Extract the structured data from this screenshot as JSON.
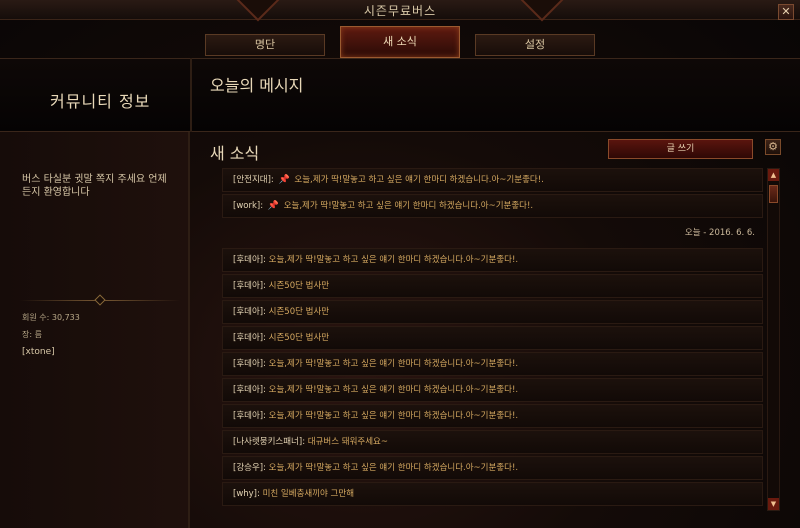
{
  "window": {
    "title": "시즌무료버스",
    "close_label": "✕"
  },
  "tabs": [
    {
      "label": "명단"
    },
    {
      "label": "새 소식"
    },
    {
      "label": "설정"
    }
  ],
  "header": {
    "community_title": "커뮤니티 정보",
    "section_title": "오늘의 메시지"
  },
  "sidebar": {
    "description": "버스 타실분 귓말 쪽지 주세요 언제든지 환영합니다",
    "member_count": "회원 수: 30,733",
    "leader_label": "장: 름",
    "leader_name": "[xtone]"
  },
  "feed": {
    "title": "새 소식",
    "write_button": "글 쓰기",
    "date_label": "오늘 - 2016. 6. 6.",
    "pinned": [
      {
        "author": "[안전지대]",
        "text": "오늘,제가 딱!말놓고 하고 싶은 얘기 한마디 하겠습니다.아~기분좋다!."
      },
      {
        "author": "[work]",
        "text": "오늘,제가 딱!말놓고 하고 싶은 얘기 한마디 하겠습니다.아~기분좋다!."
      }
    ],
    "messages": [
      {
        "author": "[후데아]",
        "text": "오늘,제가 딱!말놓고 하고 싶은 얘기 한마디 하겠습니다.아~기분좋다!."
      },
      {
        "author": "[후데아]",
        "text": "시즌50단 법사만"
      },
      {
        "author": "[후데아]",
        "text": "시즌50단 법사만"
      },
      {
        "author": "[후데아]",
        "text": "시즌50단 법사만"
      },
      {
        "author": "[후데아]",
        "text": "오늘,제가 딱!말놓고 하고 싶은 얘기 한마디 하겠습니다.아~기분좋다!."
      },
      {
        "author": "[후데아]",
        "text": "오늘,제가 딱!말놓고 하고 싶은 얘기 한마디 하겠습니다.아~기분좋다!."
      },
      {
        "author": "[후데아]",
        "text": "오늘,제가 딱!말놓고 하고 싶은 얘기 한마디 하겠습니다.아~기분좋다!."
      },
      {
        "author": "[나사렛뭉키스패너]",
        "text": "대규버스 돼워주세요~"
      },
      {
        "author": "[강승우]",
        "text": "오늘,제가 딱!말놓고 하고 싶은 얘기 한마디 하겠습니다.아~기분좋다!."
      },
      {
        "author": "[why]",
        "text": "미친 일베충새끼야 그만해"
      }
    ]
  },
  "icons": {
    "pin": "pin-icon",
    "settings": "gear-icon",
    "scroll_up": "arrow-up-icon",
    "scroll_down": "arrow-down-icon"
  },
  "colors": {
    "accent": "#d4a860",
    "active_tab": "#5e1a10"
  }
}
